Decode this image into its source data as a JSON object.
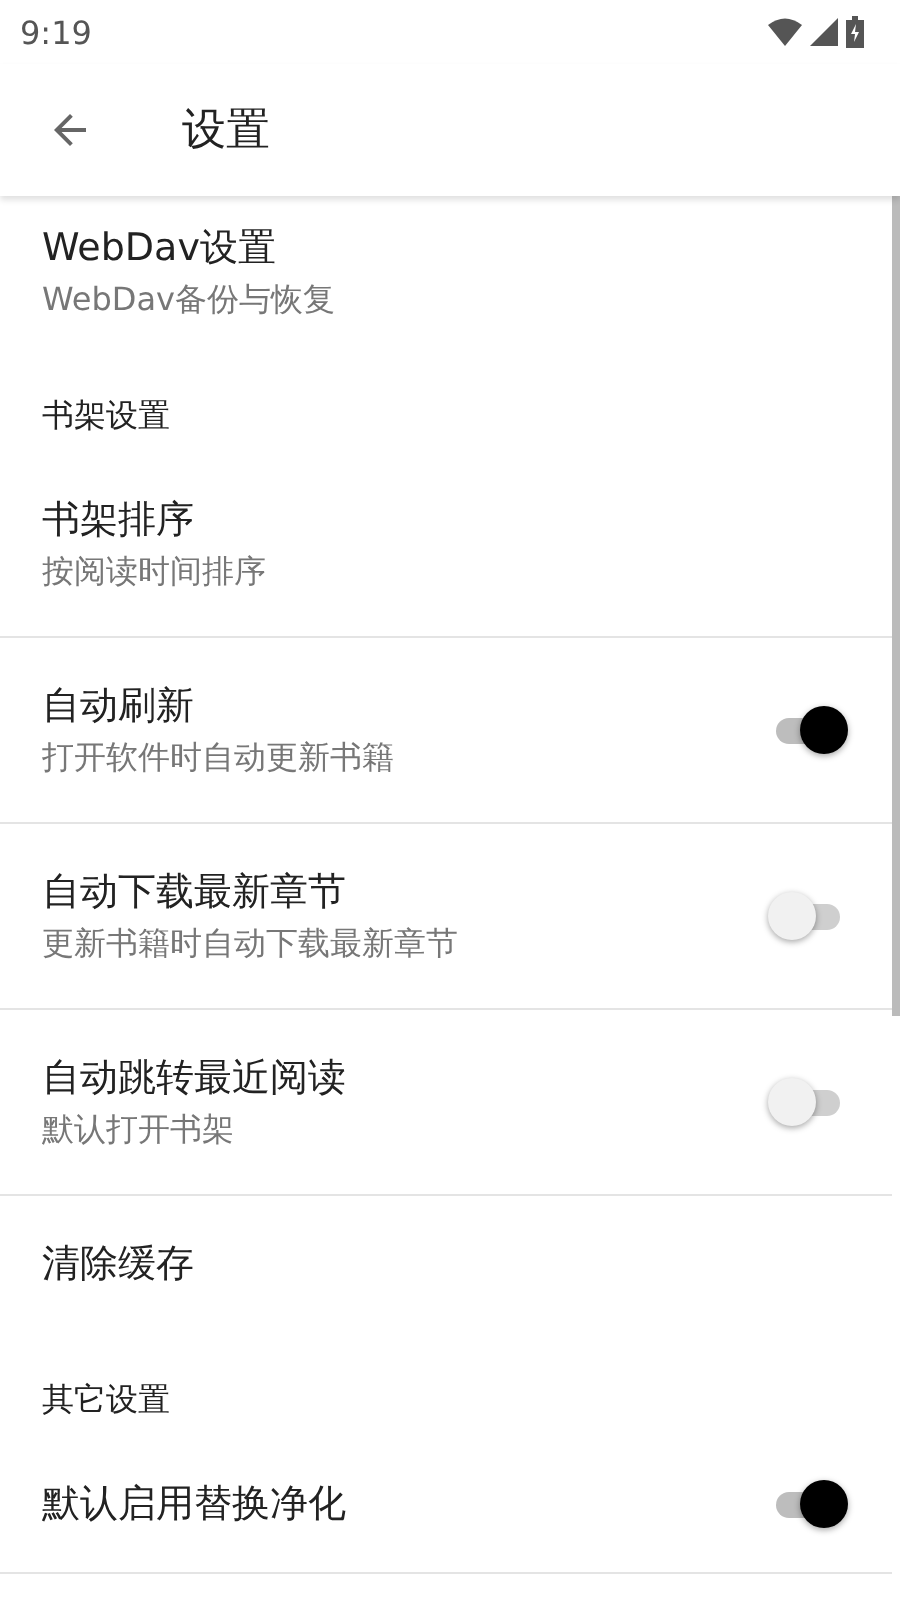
{
  "status_bar": {
    "time": "9:19"
  },
  "app_bar": {
    "title": "设置"
  },
  "items": [
    {
      "kind": "preference",
      "title": "WebDav设置",
      "summary": "WebDav备份与恢复",
      "divider": false
    },
    {
      "kind": "category",
      "title": "书架设置",
      "divider": false
    },
    {
      "kind": "preference",
      "title": "书架排序",
      "summary": "按阅读时间排序",
      "divider": true
    },
    {
      "kind": "switch",
      "title": "自动刷新",
      "summary": "打开软件时自动更新书籍",
      "on": true,
      "divider": true
    },
    {
      "kind": "switch",
      "title": "自动下载最新章节",
      "summary": "更新书籍时自动下载最新章节",
      "on": false,
      "divider": true
    },
    {
      "kind": "switch",
      "title": "自动跳转最近阅读",
      "summary": "默认打开书架",
      "on": false,
      "divider": true
    },
    {
      "kind": "preference",
      "title": "清除缓存",
      "divider": false
    },
    {
      "kind": "category",
      "title": "其它设置",
      "divider": false
    },
    {
      "kind": "switch",
      "title": "默认启用替换净化",
      "on": true,
      "divider": true
    }
  ]
}
